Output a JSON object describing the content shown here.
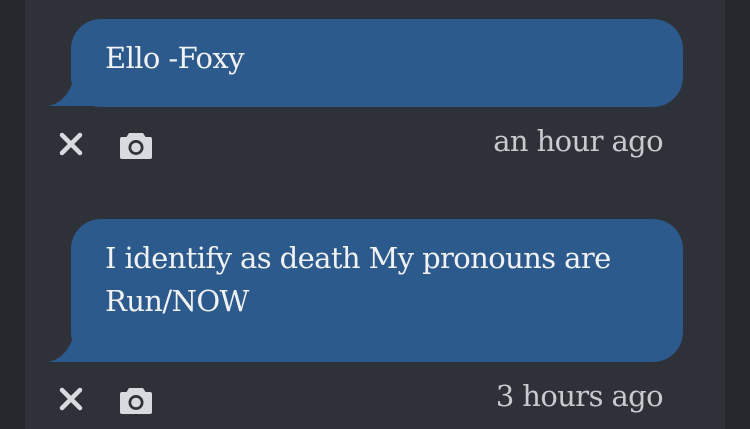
{
  "messages": [
    {
      "lines": [
        "Ello -Foxy"
      ],
      "time": "an hour ago",
      "icons": [
        "close-icon",
        "camera-icon"
      ]
    },
    {
      "lines": [
        "I identify as death My pronouns are",
        "Run/NOW"
      ],
      "time": "3 hours ago",
      "icons": [
        "close-icon",
        "camera-icon"
      ]
    }
  ],
  "colors": {
    "page_background": "#26272c",
    "column_background": "#2f3139",
    "bubble": "#2d5a8c",
    "bubble_text": "#f1f2f4",
    "timestamp_text": "#c9cad0",
    "icon": "#d9dadf"
  }
}
